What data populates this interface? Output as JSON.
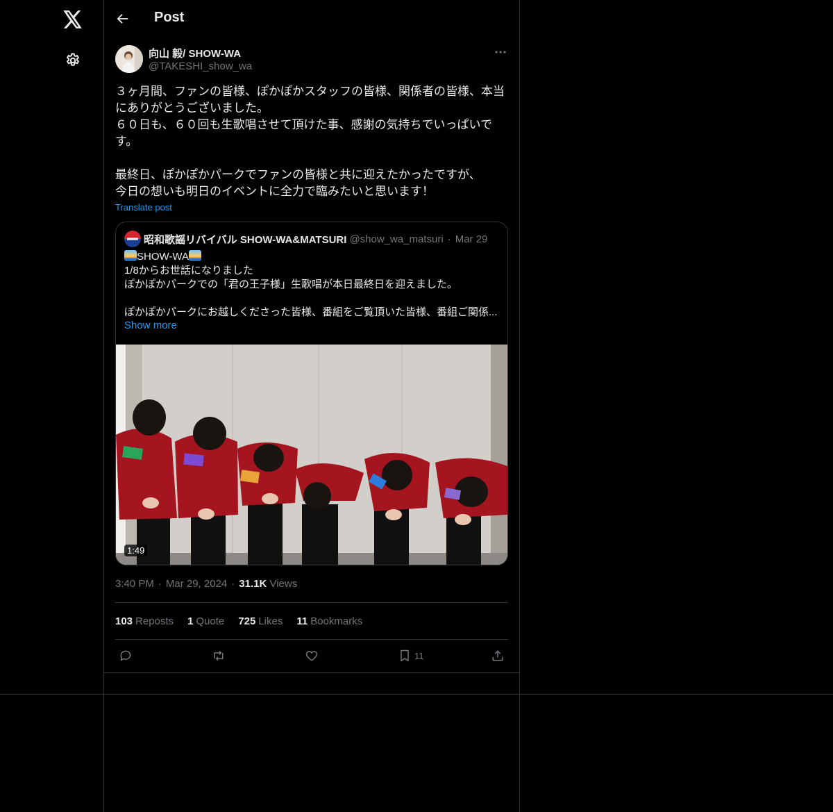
{
  "nav": {
    "logo_icon": "x-logo-icon",
    "settings_icon": "gear-icon"
  },
  "header": {
    "title": "Post",
    "back_icon": "arrow-left-icon"
  },
  "post": {
    "author_name": "向山 毅/ SHOW-WA",
    "author_handle": "@TAKESHI_show_wa",
    "text_lines": [
      "３ヶ月間、ファンの皆様、ぽかぽかスタッフの皆様、関係者の皆様、本当にありがとうございました。",
      "６０日も、６０回も生歌唱させて頂けた事、感謝の気持ちでいっぱいです。",
      "",
      "最終日、ぽかぽかパークでファンの皆様と共に迎えたかったですが、",
      "今日の想いも明日のイベントに全力で臨みたいと思います！"
    ],
    "translate_label": "Translate post",
    "time": "3:40 PM",
    "date": "Mar 29, 2024",
    "views_count": "31.1K",
    "views_label": "Views"
  },
  "quote": {
    "name": "昭和歌謡リバイバル SHOW-WA&MATSURI",
    "handle": "@show_wa_matsuri",
    "separator": "·",
    "date": "Mar 29",
    "title_text": "SHOW-WA",
    "lines": [
      "1/8からお世話になりました",
      "ぽかぽかパークでの「君の王子様」生歌唱が本日最終日を迎えました。",
      "",
      "ぽかぽかパークにお越しくださった皆様、番組をご覧頂いた皆様、番組ご関係..."
    ],
    "show_more": "Show more",
    "video_duration": "1:49"
  },
  "stats": {
    "reposts_count": "103",
    "reposts_label": "Reposts",
    "quotes_count": "1",
    "quotes_label": "Quote",
    "likes_count": "725",
    "likes_label": "Likes",
    "bookmarks_count": "11",
    "bookmarks_label": "Bookmarks"
  },
  "actions": {
    "bookmark_count": "11"
  },
  "colors": {
    "background": "#000000",
    "text": "#e7e9ea",
    "muted": "#71767b",
    "accent": "#1d9bf0",
    "border": "#2f3336"
  }
}
